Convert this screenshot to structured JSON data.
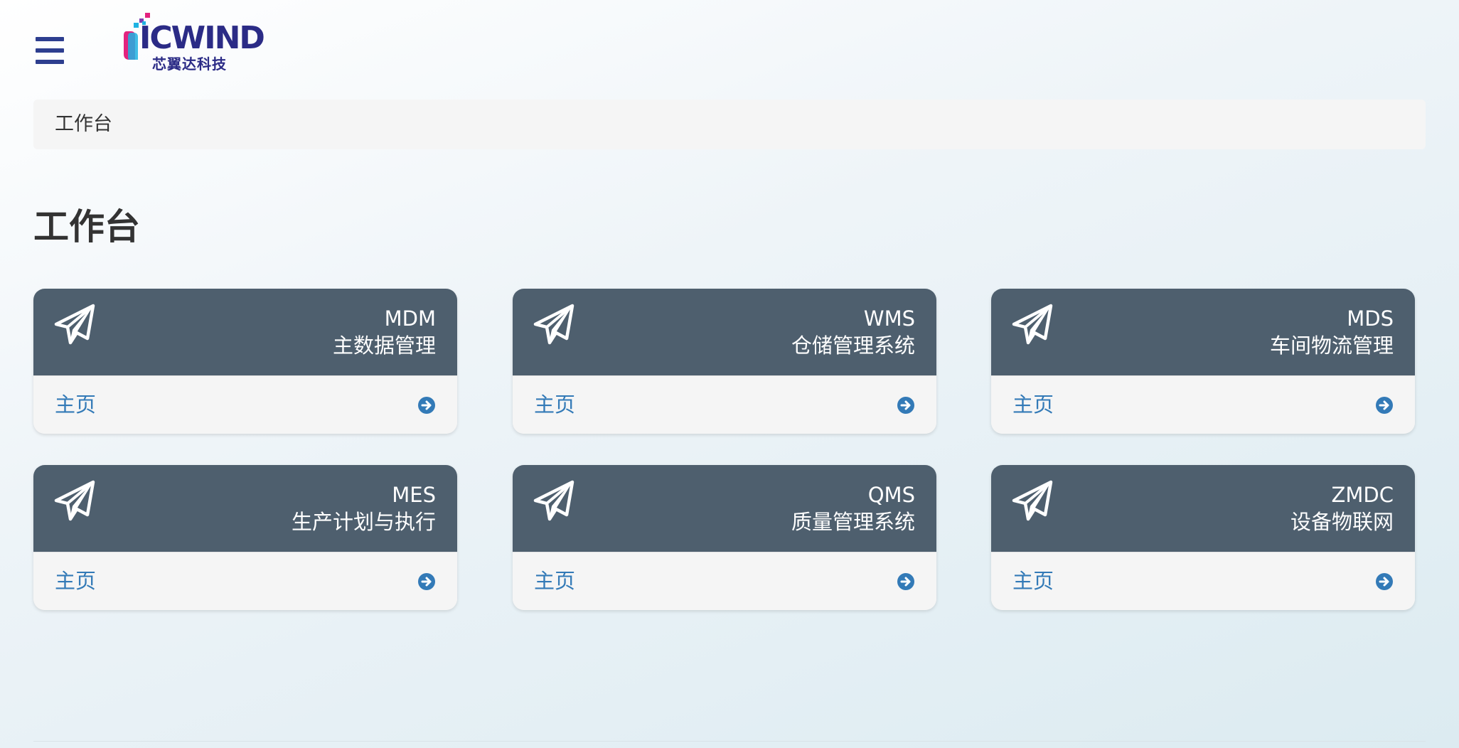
{
  "header": {
    "menu_icon": "hamburger-menu-icon",
    "logo_text": "ICWIND",
    "logo_subtitle": "芯翼达科技"
  },
  "breadcrumb": {
    "current": "工作台"
  },
  "page": {
    "title": "工作台"
  },
  "modules": [
    {
      "code": "MDM",
      "name": "主数据管理",
      "link": "主页",
      "icon": "paper-plane-icon"
    },
    {
      "code": "WMS",
      "name": "仓储管理系统",
      "link": "主页",
      "icon": "paper-plane-icon"
    },
    {
      "code": "MDS",
      "name": "车间物流管理",
      "link": "主页",
      "icon": "paper-plane-icon"
    },
    {
      "code": "MES",
      "name": "生产计划与执行",
      "link": "主页",
      "icon": "paper-plane-icon"
    },
    {
      "code": "QMS",
      "name": "质量管理系统",
      "link": "主页",
      "icon": "paper-plane-icon"
    },
    {
      "code": "ZMDC",
      "name": "设备物联网",
      "link": "主页",
      "icon": "paper-plane-icon"
    }
  ],
  "colors": {
    "card_header": "#4e5f6e",
    "link": "#337ab7",
    "brand": "#2b2b86",
    "menu_icon": "#2d3e8f"
  }
}
